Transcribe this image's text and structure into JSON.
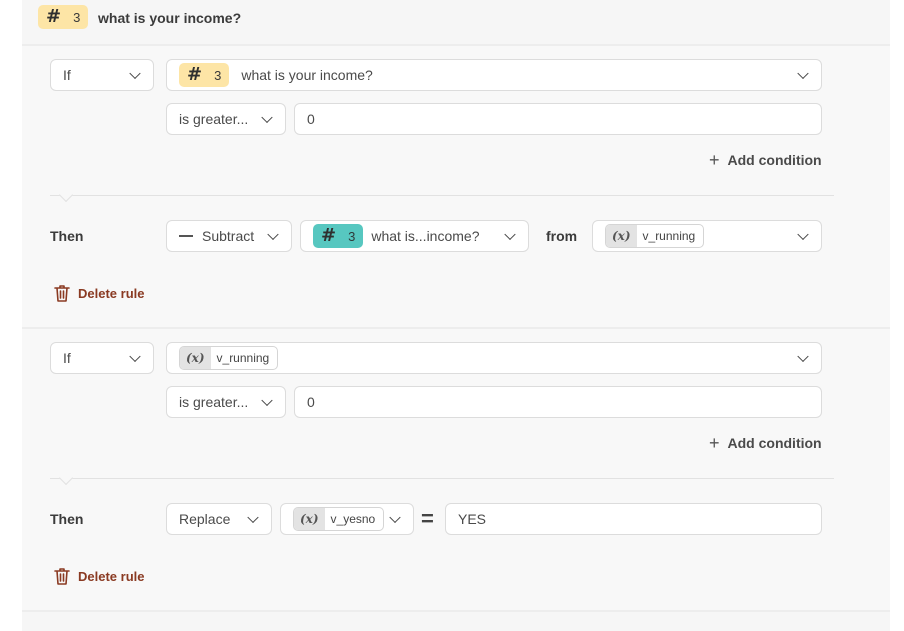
{
  "header": {
    "badge_number": "3",
    "question": "what is your income?"
  },
  "rules": [
    {
      "if_label": "If",
      "subject": {
        "badge_number": "3",
        "text": "what is your income?"
      },
      "operator": "is greater...",
      "value": "0",
      "add_condition": "Add condition",
      "then_label": "Then",
      "action": "Subtract",
      "action_operand": {
        "badge_number": "3",
        "text": "what is...income?"
      },
      "from_label": "from",
      "target_var": "v_running",
      "delete_label": "Delete rule"
    },
    {
      "if_label": "If",
      "subject_var": "v_running",
      "operator": "is greater...",
      "value": "0",
      "add_condition": "Add condition",
      "then_label": "Then",
      "action": "Replace",
      "target_var": "v_yesno",
      "equals": "=",
      "replace_value": "YES",
      "delete_label": "Delete rule"
    }
  ],
  "icons": {
    "var": "(x)",
    "hash": "#",
    "plus": "+"
  },
  "colors": {
    "yellow_badge": "#fde5a6",
    "teal_badge": "#57c7c0",
    "delete_text": "#8a3a22"
  }
}
